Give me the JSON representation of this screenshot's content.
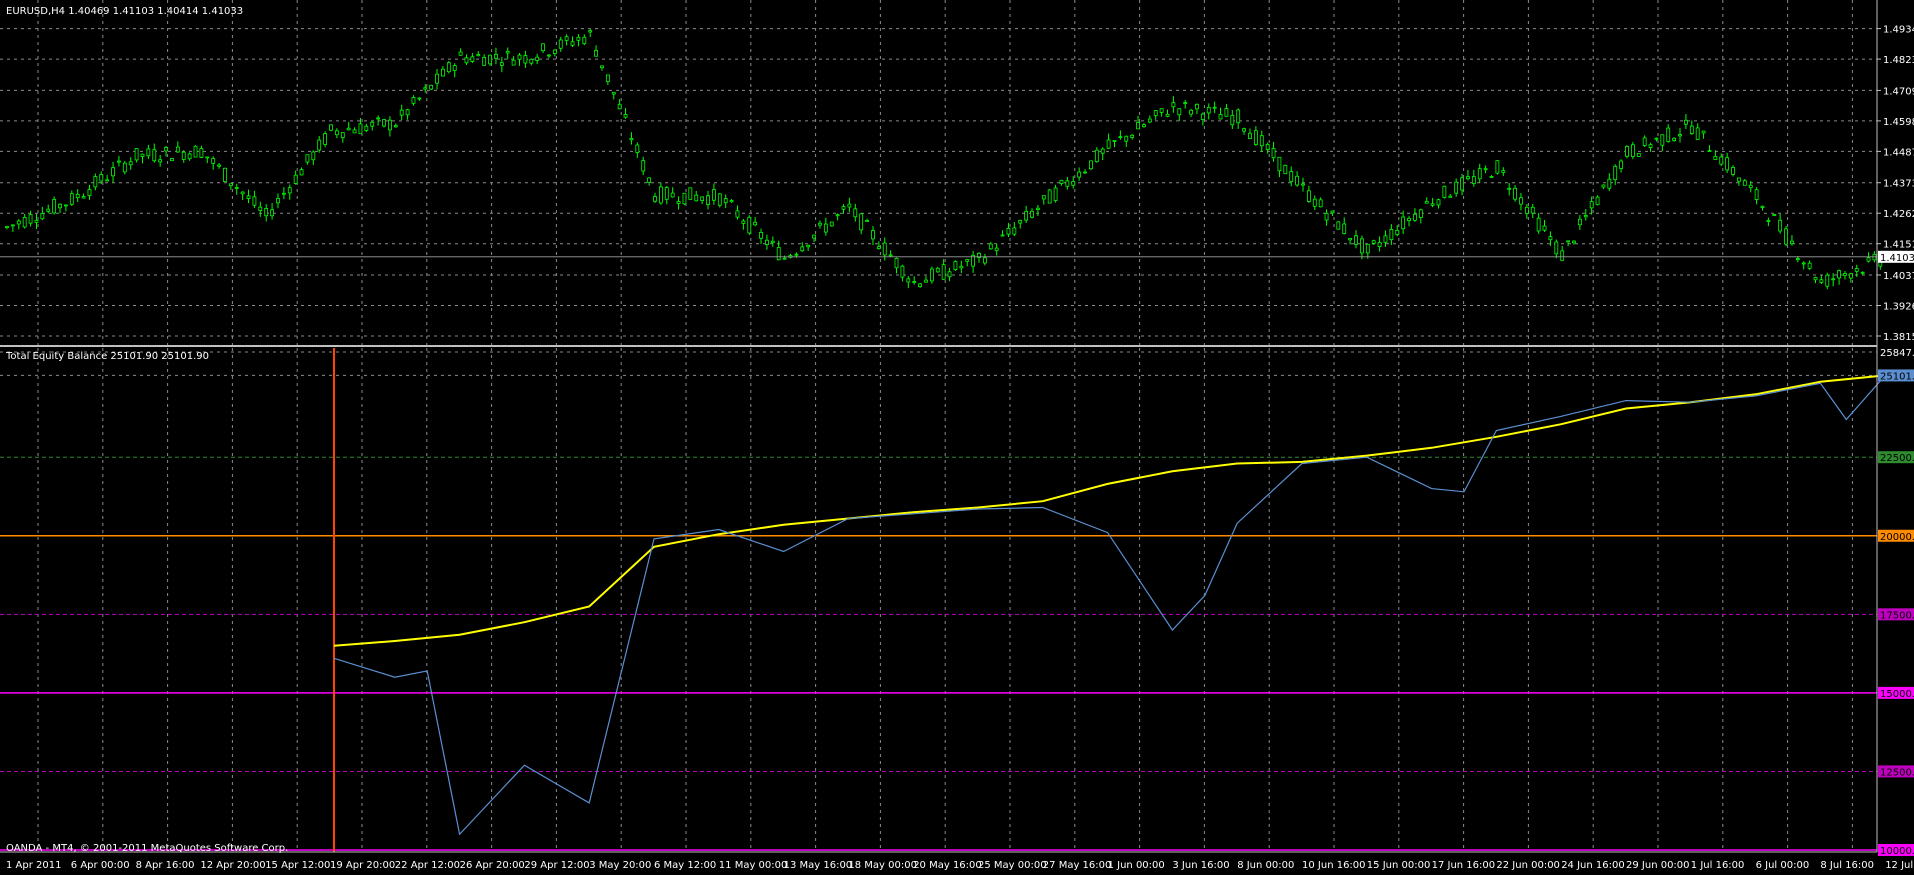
{
  "window": {
    "price_header": "EURUSD,H4  1.40469 1.41103 1.40414 1.41033",
    "indicator_header": "Total Equity Balance 25101.90 25101.90",
    "copyright": "OANDA - MT4, © 2001-2011 MetaQuotes Software Corp."
  },
  "colors": {
    "background": "#000000",
    "grid": "#8a8a8a",
    "candles": "#00ff00",
    "equity": "#5b8fd1",
    "balance": "#ffff00",
    "start_line": "#ff4500",
    "level_22500": "#2e8b2e",
    "level_20000": "#ff8c00",
    "level_17500": "#c000c0",
    "level_15000": "#ff00ff",
    "level_12500": "#c000c0",
    "level_10000": "#ff00ff"
  },
  "chart_data": [
    {
      "type": "line",
      "title": "EURUSD,H4",
      "series": [
        {
          "name": "EURUSD",
          "x": [
            "1 Apr 2011",
            "6 Apr 00:00",
            "8 Apr 16:00",
            "12 Apr 20:00",
            "15 Apr 12:00",
            "19 Apr 20:00",
            "22 Apr 12:00",
            "26 Apr 20:00",
            "29 Apr 12:00",
            "3 May 20:00",
            "6 May 12:00",
            "11 May 00:00",
            "13 May 16:00",
            "18 May 00:00",
            "20 May 16:00",
            "25 May 00:00",
            "27 May 16:00",
            "1 Jun 00:00",
            "3 Jun 16:00",
            "8 Jun 00:00",
            "10 Jun 16:00",
            "15 Jun 00:00",
            "17 Jun 16:00",
            "22 Jun 00:00",
            "24 Jun 16:00",
            "29 Jun 00:00",
            "1 Jul 16:00",
            "6 Jul 00:00",
            "8 Jul 16:00",
            "12 Jul 20:00"
          ],
          "values": [
            1.421,
            1.431,
            1.447,
            1.449,
            1.425,
            1.456,
            1.459,
            1.483,
            1.483,
            1.491,
            1.433,
            1.432,
            1.41,
            1.428,
            1.401,
            1.409,
            1.43,
            1.45,
            1.465,
            1.461,
            1.435,
            1.412,
            1.431,
            1.443,
            1.411,
            1.448,
            1.458,
            1.432,
            1.401,
            1.41
          ]
        }
      ],
      "y_ticks": [
        "1.49340",
        "1.48230",
        "1.47090",
        "1.45980",
        "1.44870",
        "1.43730",
        "1.42620",
        "1.41510",
        "1.40370",
        "1.39260",
        "1.38150"
      ],
      "current_price_label": "1.41033",
      "ylim": [
        1.3815,
        1.4958
      ],
      "grid": true
    },
    {
      "type": "line",
      "title": "Total Equity Balance",
      "series": [
        {
          "name": "Balance",
          "x": [
            "19 Apr 20:00",
            "22 Apr 12:00",
            "26 Apr 20:00",
            "29 Apr 12:00",
            "3 May 20:00",
            "6 May 12:00",
            "11 May 00:00",
            "13 May 16:00",
            "18 May 00:00",
            "20 May 16:00",
            "25 May 00:00",
            "27 May 16:00",
            "1 Jun 00:00",
            "3 Jun 16:00",
            "8 Jun 00:00",
            "10 Jun 16:00",
            "15 Jun 00:00",
            "17 Jun 16:00",
            "22 Jun 00:00",
            "24 Jun 16:00",
            "29 Jun 00:00",
            "1 Jul 16:00",
            "6 Jul 00:00",
            "8 Jul 16:00",
            "12 Jul 20:00"
          ],
          "values": [
            16500,
            16650,
            16850,
            17250,
            17750,
            19650,
            20050,
            20350,
            20550,
            20750,
            20900,
            21100,
            21650,
            22050,
            22300,
            22350,
            22550,
            22800,
            23150,
            23550,
            24050,
            24250,
            24500,
            24900,
            25101.9
          ]
        },
        {
          "name": "Equity",
          "x": [
            "19 Apr 20:00",
            "22 Apr 12:00",
            "24 Apr 16:00",
            "26 Apr 20:00",
            "29 Apr 12:00",
            "3 May 20:00",
            "6 May 12:00",
            "11 May 00:00",
            "13 May 16:00",
            "18 May 00:00",
            "20 May 16:00",
            "25 May 00:00",
            "27 May 16:00",
            "1 Jun 00:00",
            "3 Jun 16:00",
            "6 Jun 00:00",
            "8 Jun 00:00",
            "10 Jun 16:00",
            "15 Jun 00:00",
            "17 Jun 16:00",
            "20 Jun 00:00",
            "22 Jun 00:00",
            "24 Jun 16:00",
            "29 Jun 00:00",
            "1 Jul 16:00",
            "6 Jul 00:00",
            "8 Jul 16:00",
            "10 Jul 12:00",
            "12 Jul 20:00"
          ],
          "values": [
            16100,
            15500,
            15700,
            10500,
            12700,
            11500,
            19900,
            20200,
            19500,
            20550,
            20700,
            20850,
            20900,
            20100,
            17000,
            18100,
            20400,
            22300,
            22500,
            21500,
            21400,
            23350,
            23800,
            24300,
            24250,
            24450,
            24850,
            23700,
            25101.9
          ]
        }
      ],
      "y_ticks": [
        "25847.4",
        "25101.9",
        "22500.0",
        "20000.0",
        "17500.0",
        "15000.0",
        "12500.0",
        "10000.0"
      ],
      "levels": [
        22500,
        20000,
        17500,
        15000,
        12500,
        10000
      ],
      "ylim": [
        10000,
        25847.4
      ],
      "grid": true
    }
  ],
  "x_labels": [
    "1 Apr 2011",
    "6 Apr 00:00",
    "8 Apr 16:00",
    "12 Apr 20:00",
    "15 Apr 12:00",
    "19 Apr 20:00",
    "22 Apr 12:00",
    "26 Apr 20:00",
    "29 Apr 12:00",
    "3 May 20:00",
    "6 May 12:00",
    "11 May 00:00",
    "13 May 16:00",
    "18 May 00:00",
    "20 May 16:00",
    "25 May 00:00",
    "27 May 16:00",
    "1 Jun 00:00",
    "3 Jun 16:00",
    "8 Jun 00:00",
    "10 Jun 16:00",
    "15 Jun 00:00",
    "17 Jun 16:00",
    "22 Jun 00:00",
    "24 Jun 16:00",
    "29 Jun 00:00",
    "1 Jul 16:00",
    "6 Jul 00:00",
    "8 Jul 16:00",
    "12 Jul 20:00"
  ]
}
